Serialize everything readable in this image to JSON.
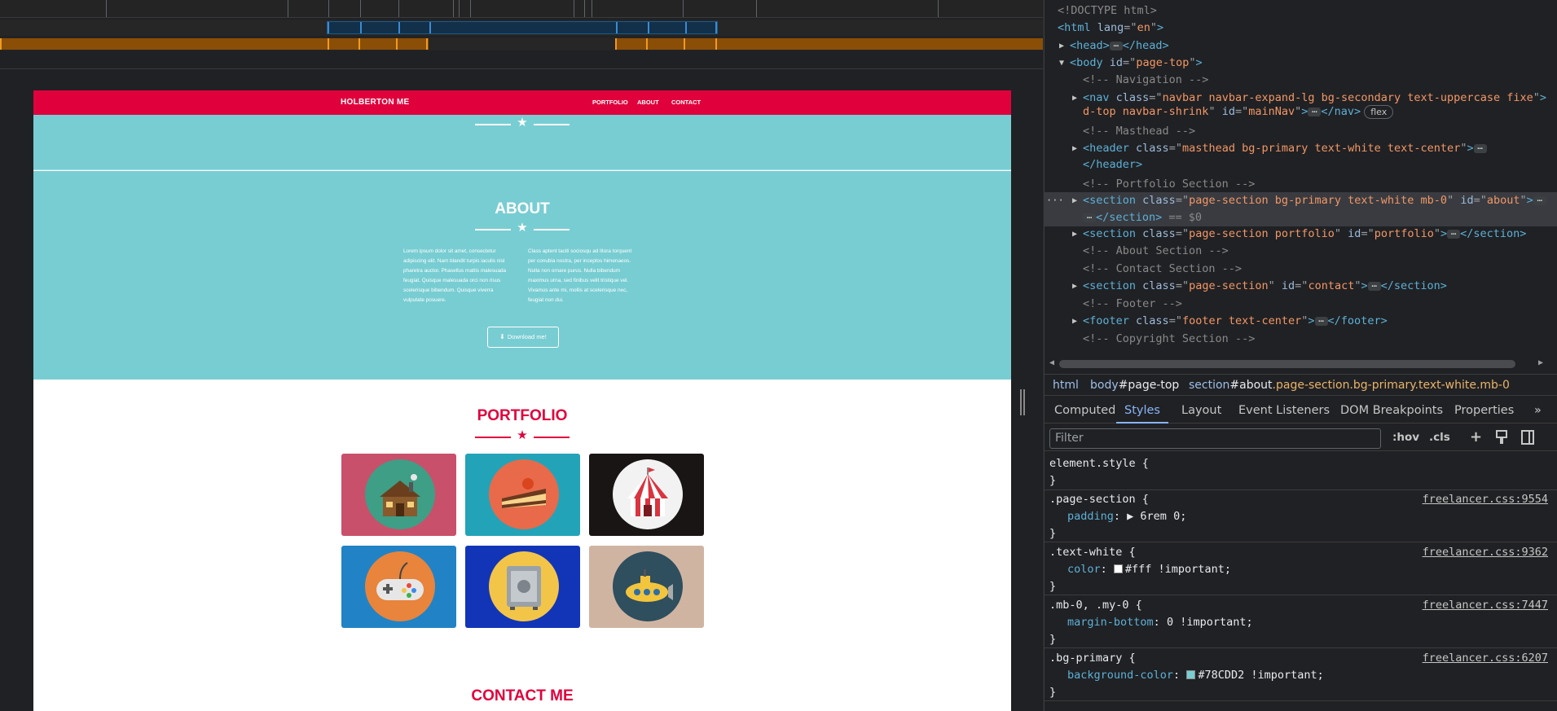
{
  "colors": {
    "brand_red": "#e0003c",
    "teal": "#78cdd2",
    "devtools_bg": "#202124",
    "tag_blue": "#5db0d7",
    "attr_value_orange": "#f29766"
  },
  "site": {
    "brand": "HOLBERTON ME",
    "nav": [
      "PORTFOLIO",
      "ABOUT",
      "CONTACT"
    ],
    "about": {
      "title": "ABOUT",
      "col_left": "Lorem ipsum dolor sit amet, consectetur adipiscing elit. Nam blandit turpis iaculis nisl pharetra auctor. Phasellus mattis malesuada feugiat. Quisque malesuada orci non risus scelerisque bibendum. Quisque viverra vulputate posuere.",
      "col_right": "Class aptent taciti sociosqu ad litora torquent per conubia nostra, per inceptos himenaeos. Nulla non ornare purus. Nulla bibendum maximus urna, sed finibus velit tristique vel. Vivamus ante mi, mollis at scelerisque nec, feugiat non dui.",
      "download_label": "Download me!"
    },
    "portfolio": {
      "title": "PORTFOLIO",
      "tiles": [
        {
          "name": "cabin",
          "bg": "#c9506a",
          "circle": "#3e9e86"
        },
        {
          "name": "cake",
          "bg": "#23a3b8",
          "circle": "#e86a4a"
        },
        {
          "name": "circus",
          "bg": "#1a1515",
          "circle": "#f2f2f2"
        },
        {
          "name": "game",
          "bg": "#2183c6",
          "circle": "#e8843c"
        },
        {
          "name": "safe",
          "bg": "#1235b8",
          "circle": "#f2c548"
        },
        {
          "name": "submarine",
          "bg": "#d0b4a2",
          "circle": "#2f4e5e"
        }
      ]
    },
    "contact": {
      "title": "CONTACT ME"
    }
  },
  "devtools": {
    "tree": [
      {
        "indent": 0,
        "type": "doctype",
        "text": "<!DOCTYPE html>"
      },
      {
        "indent": 0,
        "type": "open",
        "tag": "html",
        "attrs": [
          [
            "lang",
            "en"
          ]
        ]
      },
      {
        "indent": 1,
        "type": "collapsed",
        "tag": "head"
      },
      {
        "indent": 1,
        "type": "open-expanded",
        "tag": "body",
        "attrs": [
          [
            "id",
            "page-top"
          ]
        ]
      },
      {
        "indent": 2,
        "type": "comment",
        "text": "<!-- Navigation -->"
      },
      {
        "indent": 2,
        "type": "collapsed-wrap",
        "tag": "nav",
        "attrs": [
          [
            "class",
            "navbar navbar-expand-lg bg-secondary text-uppercase fixe"
          ]
        ],
        "wrap": "d-top navbar-shrink\"",
        "id_attr": "mainNav",
        "badge": "flex"
      },
      {
        "indent": 2,
        "type": "comment",
        "text": "<!-- Masthead -->"
      },
      {
        "indent": 2,
        "type": "collapsed-header",
        "tag": "header",
        "attrs": [
          [
            "class",
            "masthead bg-primary text-white text-center"
          ]
        ]
      },
      {
        "indent": 2,
        "type": "comment",
        "text": "<!-- Portfolio Section -->"
      },
      {
        "indent": 2,
        "type": "selected",
        "tag": "section",
        "attrs": [
          [
            "class",
            "page-section bg-primary text-white mb-0"
          ],
          [
            "id",
            "about"
          ]
        ],
        "suffix": "== $0"
      },
      {
        "indent": 2,
        "type": "collapsed",
        "tag": "section",
        "attrs": [
          [
            "class",
            "page-section portfolio"
          ],
          [
            "id",
            "portfolio"
          ]
        ]
      },
      {
        "indent": 2,
        "type": "comment",
        "text": "<!-- About Section -->"
      },
      {
        "indent": 2,
        "type": "comment",
        "text": "<!-- Contact Section -->"
      },
      {
        "indent": 2,
        "type": "collapsed",
        "tag": "section",
        "attrs": [
          [
            "class",
            "page-section"
          ],
          [
            "id",
            "contact"
          ]
        ]
      },
      {
        "indent": 2,
        "type": "comment",
        "text": "<!-- Footer -->"
      },
      {
        "indent": 2,
        "type": "collapsed",
        "tag": "footer",
        "attrs": [
          [
            "class",
            "footer text-center"
          ]
        ]
      },
      {
        "indent": 2,
        "type": "comment",
        "text": "<!-- Copyright Section -->"
      }
    ],
    "breadcrumbs": [
      {
        "tag": "html",
        "rest": ""
      },
      {
        "tag": "body",
        "id": "#page-top",
        "rest": ""
      },
      {
        "tag": "section",
        "id": "#about",
        "rest": ".page-section.bg-primary.text-white.mb-0"
      }
    ],
    "tabs": [
      "Computed",
      "Styles",
      "Layout",
      "Event Listeners",
      "DOM Breakpoints",
      "Properties",
      "»"
    ],
    "active_tab": "Styles",
    "filter_placeholder": "Filter",
    "tools": [
      ":hov",
      ".cls",
      "+"
    ],
    "rules": [
      {
        "selector": "element.style {",
        "props": [],
        "source": ""
      },
      {
        "selector": ".page-section {",
        "props": [
          {
            "name": "padding",
            "value": "▶ 6rem 0;"
          }
        ],
        "source": "freelancer.css:9554"
      },
      {
        "selector": ".text-white {",
        "props": [
          {
            "name": "color",
            "value": "#fff !important;",
            "swatch": "#ffffff"
          }
        ],
        "source": "freelancer.css:9362"
      },
      {
        "selector": ".mb-0, .my-0 {",
        "props": [
          {
            "name": "margin-bottom",
            "value": "0 !important;"
          }
        ],
        "source": "freelancer.css:7447"
      },
      {
        "selector": ".bg-primary {",
        "props": [
          {
            "name": "background-color",
            "value": "#78CDD2 !important;",
            "swatch": "#78cdd2"
          }
        ],
        "source": "freelancer.css:6207"
      }
    ]
  }
}
